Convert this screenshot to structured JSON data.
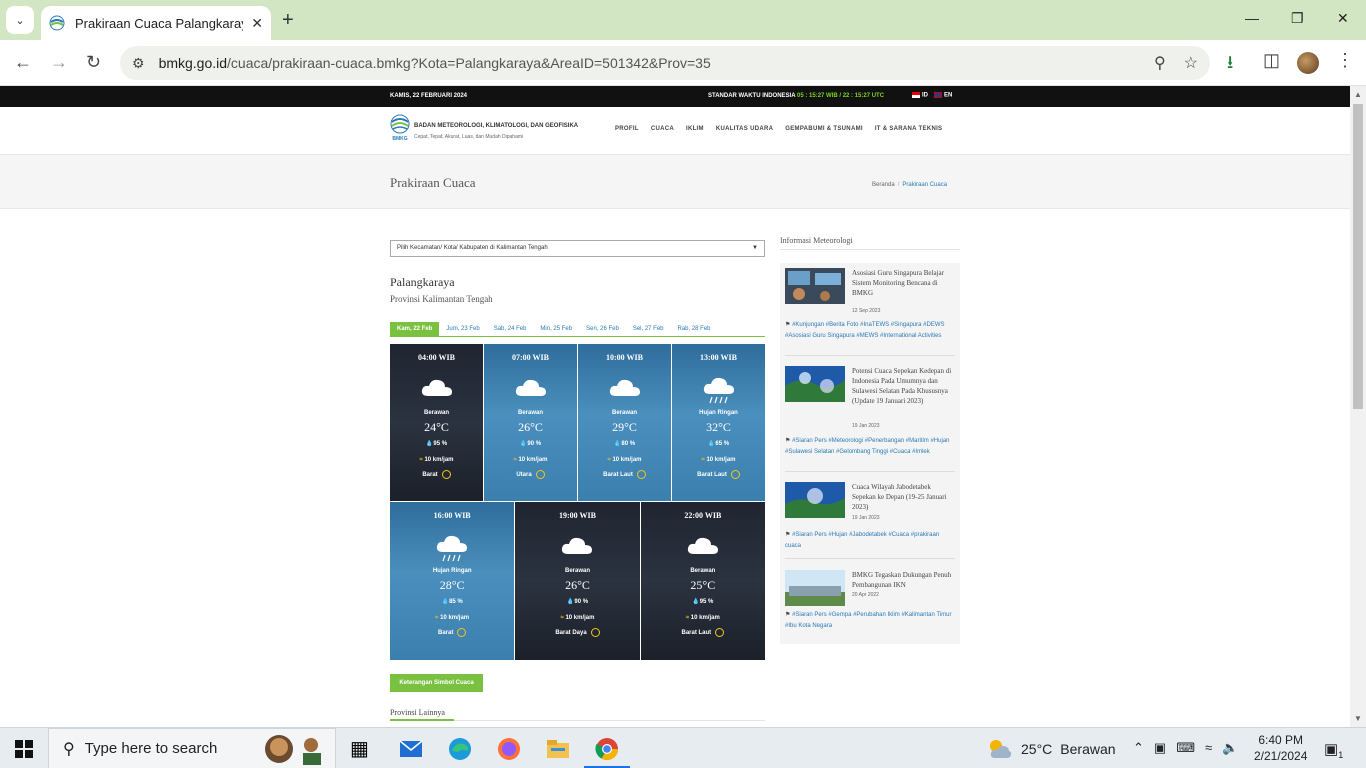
{
  "browser": {
    "tab_title": "Prakiraan Cuaca Palangkaraya - BMKG",
    "url_host": "bmkg.go.id",
    "url_path": "/cuaca/prakiraan-cuaca.bmkg?Kota=Palangkaraya&AreaID=501342&Prov=35"
  },
  "topstrip": {
    "date": "KAMIS, 22 FEBRUARI 2024",
    "time_label": "STANDAR WAKTU INDONESIA",
    "time_value": "05 : 15:27 WIB / 22 : 15:27 UTC",
    "lang_id": "ID",
    "lang_en": "EN"
  },
  "header": {
    "org": "BADAN METEOROLOGI, KLIMATOLOGI, DAN GEOFISIKA",
    "tagline": "Cepat, Tepat, Akurat, Luas, dan Mudah Dipahami",
    "logo_text": "BMKG",
    "menu": [
      "PROFIL",
      "CUACA",
      "IKLIM",
      "KUALITAS UDARA",
      "GEMPABUMI & TSUNAMI",
      "IT & SARANA TEKNIS"
    ]
  },
  "titlebar": {
    "title": "Prakiraan Cuaca",
    "crumb_home": "Beranda",
    "crumb_current": "Prakiraan Cuaca"
  },
  "main": {
    "select_placeholder": "Pilih Kecamatan/ Kota/ Kabupaten di Kalimantan Tengah",
    "city": "Palangkaraya",
    "province": "Provinsi Kalimantan Tengah",
    "day_tabs": [
      "Kam, 22 Feb",
      "Jum, 23 Feb",
      "Sab, 24 Feb",
      "Min, 25 Feb",
      "Sen, 26 Feb",
      "Sel, 27 Feb",
      "Rab, 28 Feb"
    ],
    "forecasts": [
      {
        "time": "04:00 WIB",
        "cond": "Berawan",
        "temp": "24°C",
        "hum": "95 %",
        "wind": "10 km/jam",
        "dir": "Barat"
      },
      {
        "time": "07:00 WIB",
        "cond": "Berawan",
        "temp": "26°C",
        "hum": "90 %",
        "wind": "10 km/jam",
        "dir": "Utara"
      },
      {
        "time": "10:00 WIB",
        "cond": "Berawan",
        "temp": "29°C",
        "hum": "80 %",
        "wind": "10 km/jam",
        "dir": "Barat Laut"
      },
      {
        "time": "13:00 WIB",
        "cond": "Hujan Ringan",
        "temp": "32°C",
        "hum": "65 %",
        "wind": "10 km/jam",
        "dir": "Barat Laut"
      },
      {
        "time": "16:00 WIB",
        "cond": "Hujan Ringan",
        "temp": "28°C",
        "hum": "85 %",
        "wind": "10 km/jam",
        "dir": "Barat"
      },
      {
        "time": "19:00 WIB",
        "cond": "Berawan",
        "temp": "26°C",
        "hum": "90 %",
        "wind": "10 km/jam",
        "dir": "Barat Daya"
      },
      {
        "time": "22:00 WIB",
        "cond": "Berawan",
        "temp": "25°C",
        "hum": "95 %",
        "wind": "10 km/jam",
        "dir": "Barat Laut"
      }
    ],
    "legend_button": "Keterangan Simbol Cuaca",
    "other_provinces": "Provinsi Lainnya"
  },
  "sidebar": {
    "title": "Informasi Meteorologi",
    "news": [
      {
        "headline": "Asosiasi Guru Singapura Belajar Sistem Monitoring Bencana di BMKG",
        "date": "12 Sep 2023",
        "tags": "#Kunjungan #Berita Foto #InaTEWS #Singapura #DEWS #Asosiasi Guru Singapura #MEWS #International Activities"
      },
      {
        "headline": "Potensi Cuaca Sepekan Kedepan di Indonesia Pada Umumnya dan Sulawesi Selatan Pada Khususnya (Update 19 Januari 2023)",
        "date": "19 Jan 2023",
        "tags": "#Siaran Pers #Meteorologi #Penerbangan #Maritim #Hujan #Sulawesi Selatan #Gelombang Tinggi #Cuaca #Imlek"
      },
      {
        "headline": "Cuaca Wilayah Jabodetabek Sepekan ke Depan (19-25 Januari 2023)",
        "date": "19 Jan 2023",
        "tags": "#Siaran Pers #Hujan #Jabodetabek #Cuaca #prakiraan cuaca"
      },
      {
        "headline": "BMKG Tegaskan Dukungan Penuh Pembangunan IKN",
        "date": "20 Apr 2022",
        "tags": "#Siaran Pers #Gempa #Perubahan Iklim #Kalimantan Timur #Ibu Kota Negara"
      }
    ]
  },
  "taskbar": {
    "search_placeholder": "Type here to search",
    "weather_temp": "25°C",
    "weather_cond": "Berawan",
    "time": "6:40 PM",
    "date": "2/21/2024",
    "notif_count": "1"
  }
}
